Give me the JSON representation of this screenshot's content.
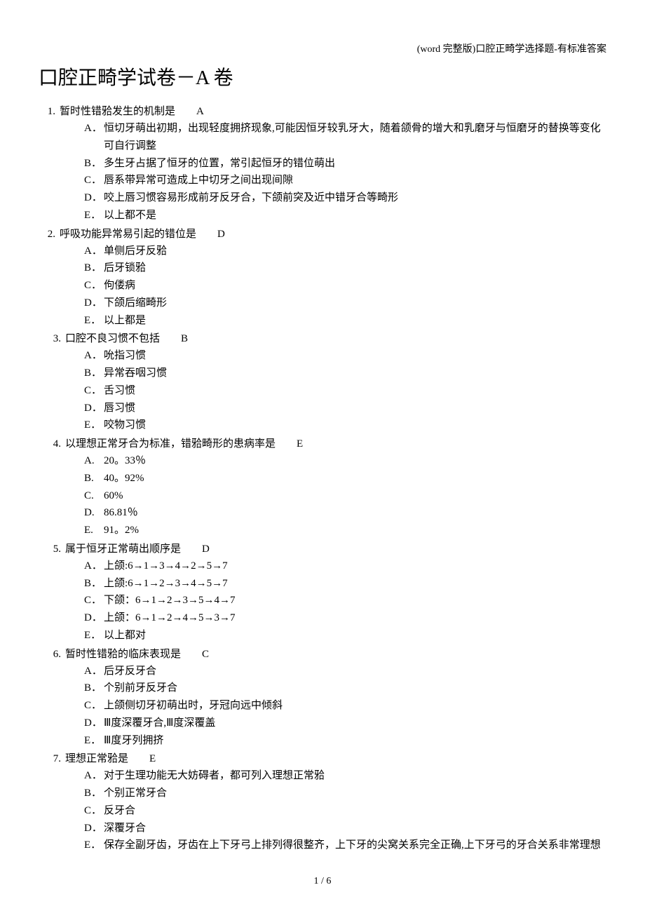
{
  "header_note": "(word 完整版)口腔正畸学选择题-有标准答案",
  "title": "口腔正畸学试卷－A 卷",
  "questions": [
    {
      "num": "1.",
      "stem": "暂时性错𬌗发生的机制是",
      "answer": "A",
      "options": [
        {
          "letter": "A．",
          "text": "恒切牙萌出初期，出现轻度拥挤现象,可能因恒牙较乳牙大，随着颌骨的增大和乳磨牙与恒磨牙的替换等变化可自行调整"
        },
        {
          "letter": "B．",
          "text": "多生牙占据了恒牙的位置，常引起恒牙的错位萌出"
        },
        {
          "letter": "C．",
          "text": "唇系带异常可造成上中切牙之间出现间隙"
        },
        {
          "letter": "D．",
          "text": "咬上唇习惯容易形成前牙反牙合，下颌前突及近中错牙合等畸形"
        },
        {
          "letter": "E．",
          "text": "以上都不是"
        }
      ]
    },
    {
      "num": "2.",
      "stem": "呼吸功能异常易引起的错位是",
      "answer": "D",
      "options": [
        {
          "letter": "A．",
          "text": "单侧后牙反𬌗"
        },
        {
          "letter": "B．",
          "text": "后牙锁𬌗"
        },
        {
          "letter": "C．",
          "text": "佝偻病"
        },
        {
          "letter": "D．",
          "text": "下颌后缩畸形"
        },
        {
          "letter": "E．",
          "text": "以上都是"
        }
      ]
    },
    {
      "num": "3.",
      "stem": "口腔不良习惯不包括",
      "answer": "B",
      "options": [
        {
          "letter": "A．",
          "text": "吮指习惯"
        },
        {
          "letter": "B．",
          "text": "异常吞咽习惯"
        },
        {
          "letter": "C．",
          "text": "舌习惯"
        },
        {
          "letter": "D．",
          "text": "唇习惯"
        },
        {
          "letter": "E．",
          "text": "咬物习惯"
        }
      ]
    },
    {
      "num": "4.",
      "stem": "以理想正常牙合为标准，错𬌗畸形的患病率是",
      "answer": "E",
      "options": [
        {
          "letter": "A.",
          "text": "20。33％"
        },
        {
          "letter": "B.",
          "text": "40。92%"
        },
        {
          "letter": "C.",
          "text": "60%"
        },
        {
          "letter": "D.",
          "text": "86.81％"
        },
        {
          "letter": "E.",
          "text": "91。2%"
        }
      ]
    },
    {
      "num": "5.",
      "stem": "属于恒牙正常萌出顺序是",
      "answer": "D",
      "options": [
        {
          "letter": "A．",
          "text": "上颌:6→1→3→4→2→5→7"
        },
        {
          "letter": "B．",
          "text": "上颌:6→1→2→3→4→5→7"
        },
        {
          "letter": "C．",
          "text": "下颌：6→1→2→3→5→4→7"
        },
        {
          "letter": "D．",
          "text": "上颌：6→1→2→4→5→3→7"
        },
        {
          "letter": "E．",
          "text": "以上都对"
        }
      ]
    },
    {
      "num": "6.",
      "stem": "暂时性错𬌗的临床表现是",
      "answer": "C",
      "options": [
        {
          "letter": "A．",
          "text": "后牙反牙合"
        },
        {
          "letter": "B．",
          "text": "个别前牙反牙合"
        },
        {
          "letter": "C．",
          "text": "上颌侧切牙初萌出时，牙冠向远中倾斜"
        },
        {
          "letter": "D．",
          "text": "Ⅲ度深覆牙合,Ⅲ度深覆盖"
        },
        {
          "letter": "E．",
          "text": "Ⅲ度牙列拥挤"
        }
      ]
    },
    {
      "num": "7.",
      "stem": "理想正常𬌗是",
      "answer": "E",
      "options": [
        {
          "letter": "A．",
          "text": "对于生理功能无大妨碍者，都可列入理想正常𬌗"
        },
        {
          "letter": "B．",
          "text": "个别正常牙合"
        },
        {
          "letter": "C．",
          "text": "反牙合"
        },
        {
          "letter": "D．",
          "text": "深覆牙合"
        },
        {
          "letter": "E．",
          "text": "保存全副牙齿，牙齿在上下牙弓上排列得很整齐，上下牙的尖窝关系完全正确,上下牙弓的牙合关系非常理想"
        }
      ]
    }
  ],
  "footer": "1 / 6"
}
